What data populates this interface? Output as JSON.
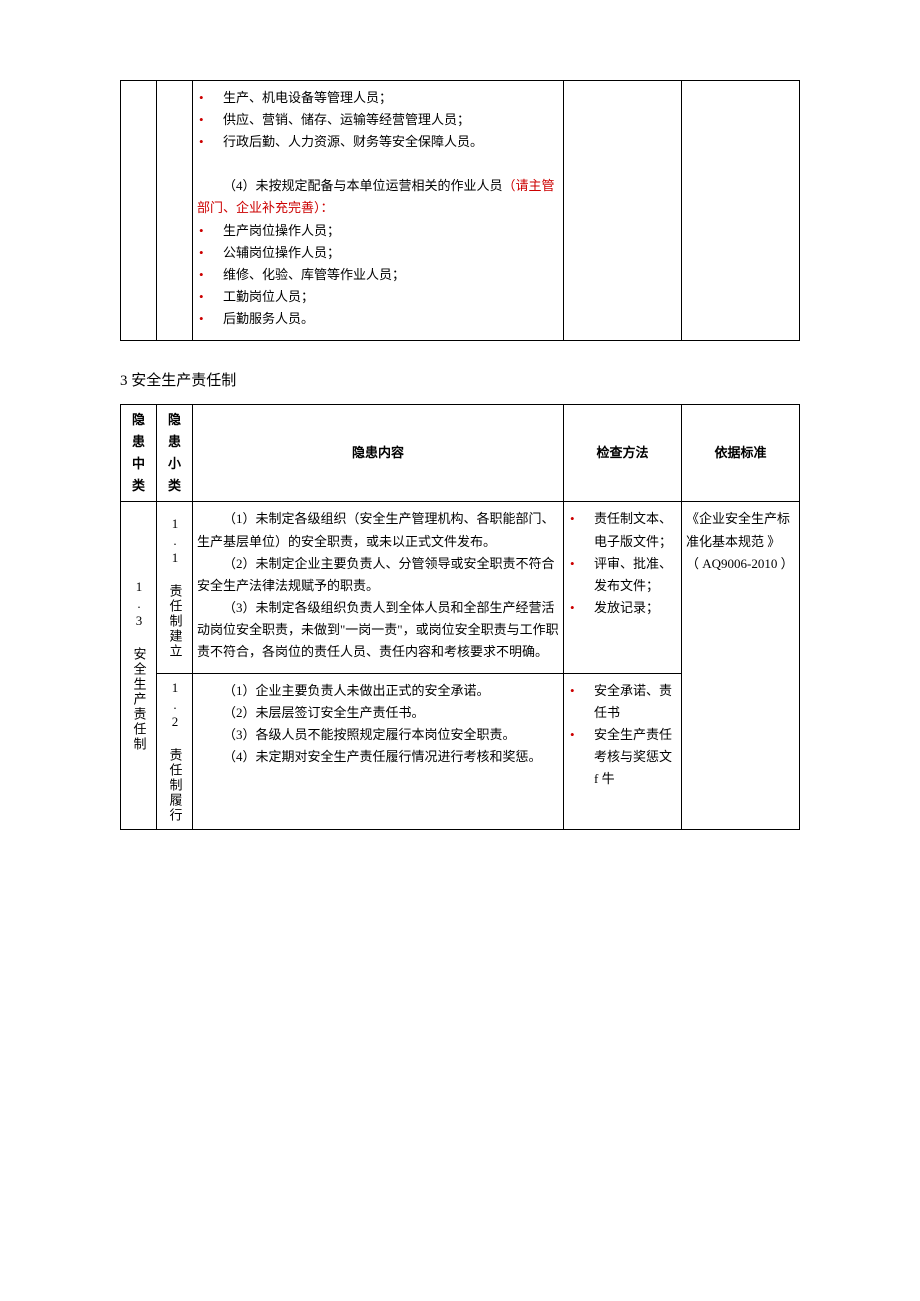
{
  "table1": {
    "content": {
      "bullets1": [
        "生产、机电设备等管理人员；",
        "供应、营销、储存、运输等经营管理人员；",
        "行政后勤、人力资源、财务等安全保障人员。"
      ],
      "line4_a": "（4）未按规定配备与本单位运营相关的作业人员",
      "line4_b": "（请主管部门、企业补充完善）：",
      "bullets2": [
        "生产岗位操作人员；",
        "公辅岗位操作人员；",
        "维修、化验、库管等作业人员；",
        "工勤岗位人员；",
        "后勤服务人员。"
      ]
    }
  },
  "section_title": "3 安全生产责任制",
  "table2": {
    "headers": {
      "h1": "隐患中类",
      "h2": "隐患小类",
      "h3": "隐患内容",
      "h4": "检查方法",
      "h5": "依据标准"
    },
    "row1": {
      "mid": "1.3 安全生产责任制",
      "small": "1.1 责任制建立",
      "content": {
        "p1": "（1）未制定各级组织（安全生产管理机构、各职能部门、生产基层单位）的安全职责，或未以正式文件发布。",
        "p2": "（2）未制定企业主要负责人、分管领导或安全职责不符合安全生产法律法规赋予的职责。",
        "p3": "（3）未制定各级组织负责人到全体人员和全部生产经营活动岗位安全职责，未做到\"一岗一责\"，或岗位安全职责与工作职责不符合，各岗位的责任人员、责任内容和考核要求不明确。"
      },
      "method": [
        "责任制文本、电子版文件；",
        "评审、批准、发布文件；",
        "发放记录；"
      ],
      "std_a": "《企业安全生产标准化基本规范 》",
      "std_b": "（ AQ9006-2010 ）"
    },
    "row2": {
      "small": "1.2 责任制履行",
      "content": {
        "p1": "（1）企业主要负责人未做出正式的安全承诺。",
        "p2": "（2）未层层签订安全生产责任书。",
        "p3": "（3）各级人员不能按照规定履行本岗位安全职责。",
        "p4": "（4）未定期对安全生产责任履行情况进行考核和奖惩。"
      },
      "method": [
        "安全承诺、责任书",
        "安全生产责任考核与奖惩文 f 牛"
      ]
    }
  }
}
